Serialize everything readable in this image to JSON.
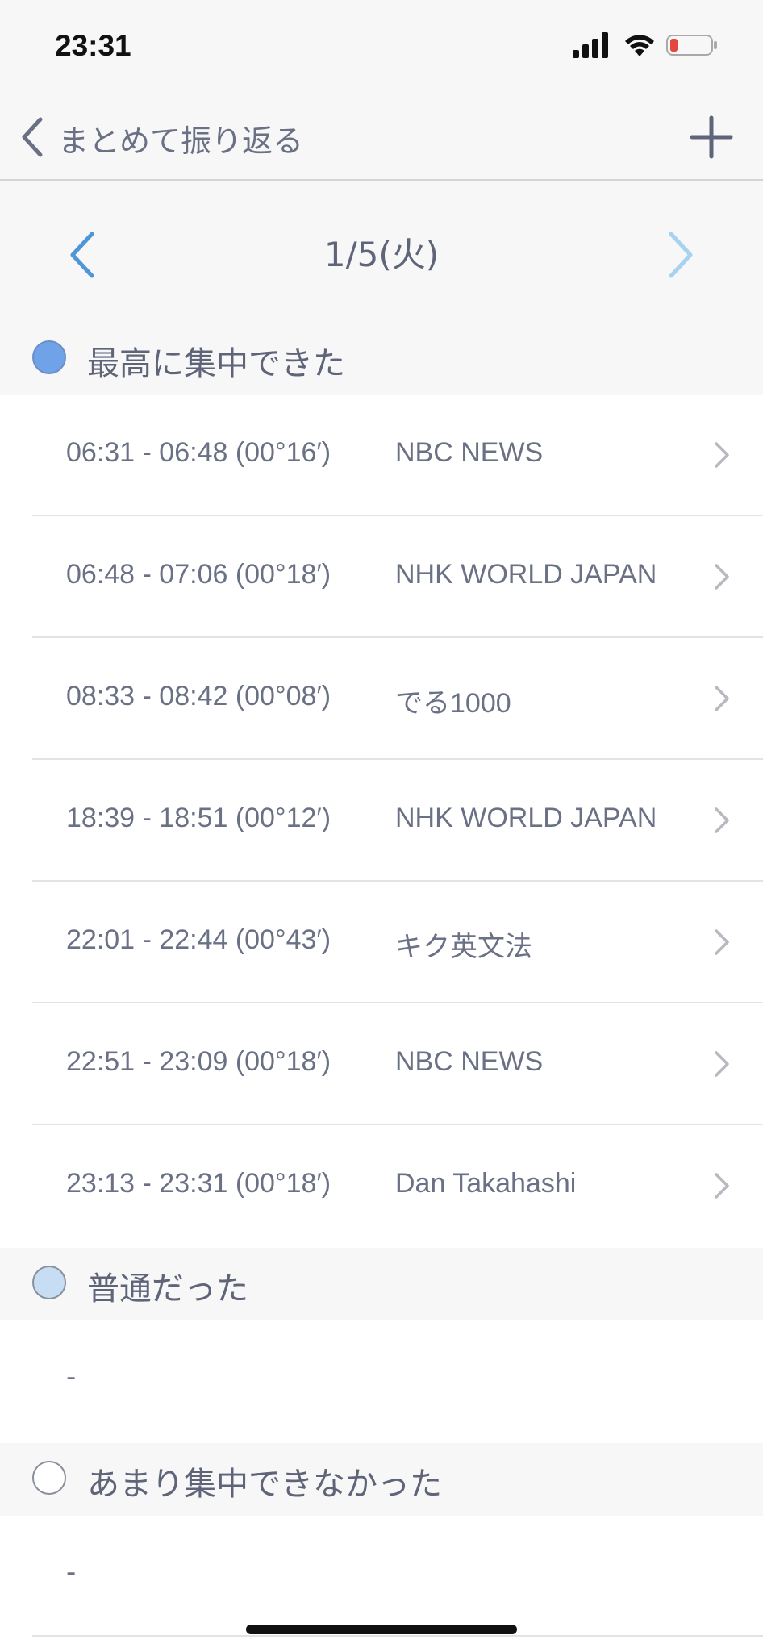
{
  "status_bar": {
    "time": "23:31"
  },
  "nav": {
    "back_label": "まとめて振り返る"
  },
  "date": {
    "label": "1/5(火)"
  },
  "sections": [
    {
      "label": "最高に集中できた",
      "color": "#6fa2e6",
      "items": [
        {
          "time": "06:31 - 06:48 (00°16′)",
          "title": "NBC NEWS"
        },
        {
          "time": "06:48 - 07:06 (00°18′)",
          "title": "NHK WORLD JAPAN"
        },
        {
          "time": "08:33 - 08:42 (00°08′)",
          "title": "でる1000"
        },
        {
          "time": "18:39 - 18:51 (00°12′)",
          "title": "NHK WORLD JAPAN"
        },
        {
          "time": "22:01 - 22:44 (00°43′)",
          "title": "キク英文法"
        },
        {
          "time": "22:51 - 23:09 (00°18′)",
          "title": "NBC NEWS"
        },
        {
          "time": "23:13 - 23:31 (00°18′)",
          "title": "Dan Takahashi"
        }
      ]
    },
    {
      "label": "普通だった",
      "color": "#c6ddf3",
      "empty_text": "-"
    },
    {
      "label": "あまり集中できなかった",
      "color": "#ffffff",
      "empty_text": "-"
    }
  ]
}
